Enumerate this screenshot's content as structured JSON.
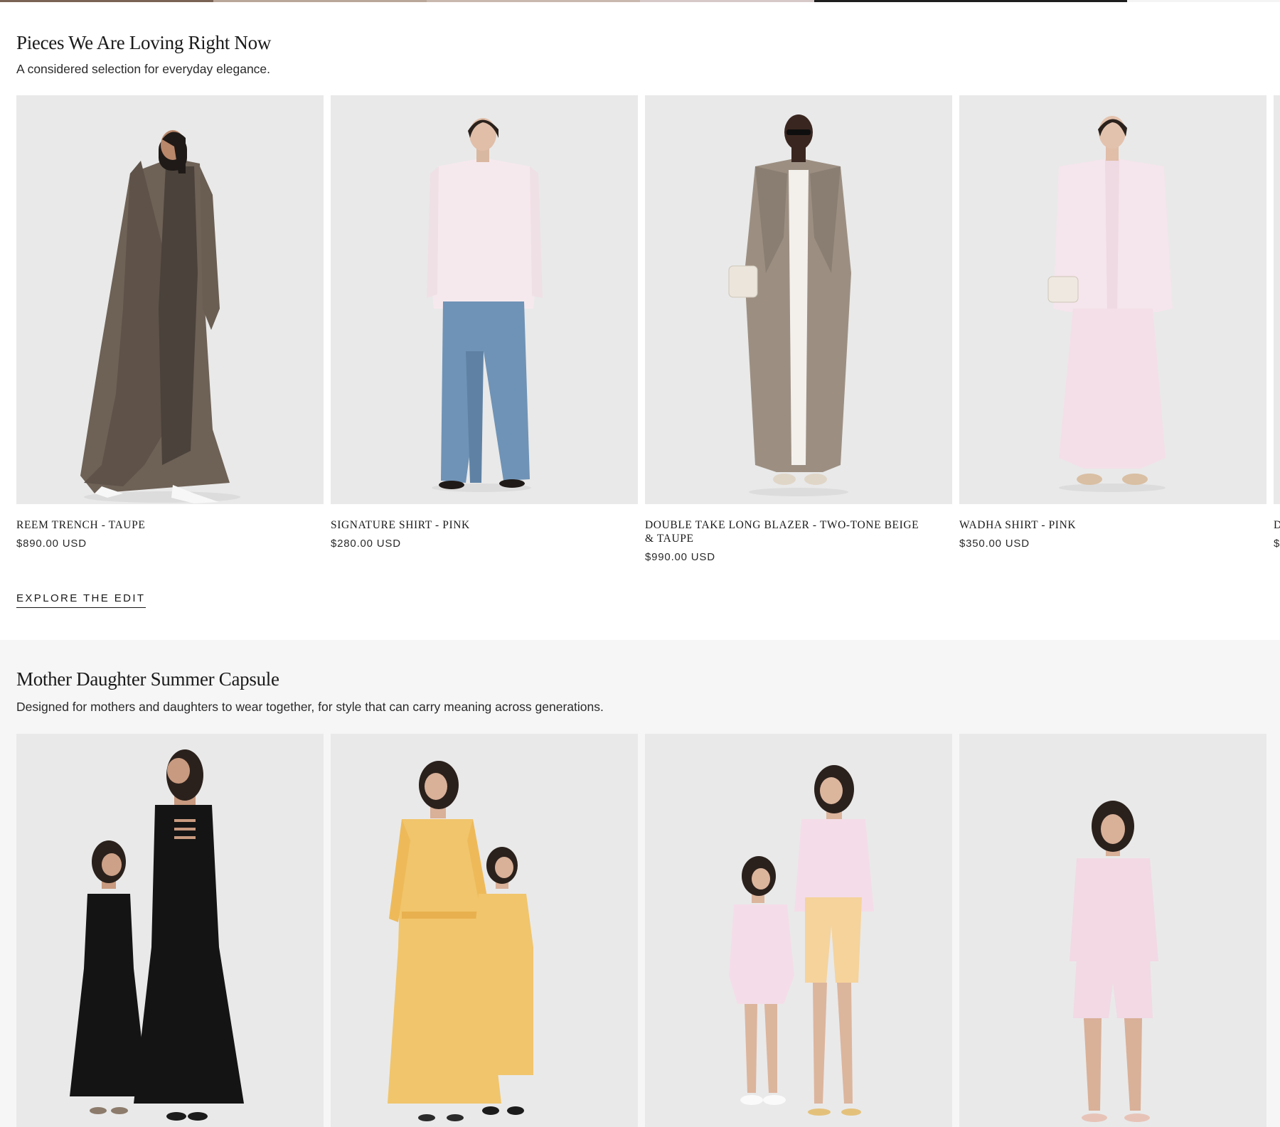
{
  "top_strip": {
    "colors": [
      "#7a6354",
      "#b9a79a",
      "#c9b8ae",
      "#d8c9c9",
      "#1e1e1e",
      "#f4f4f4"
    ]
  },
  "featured": {
    "title": "Pieces We Are Loving Right Now",
    "subtitle": "A considered selection for everyday elegance.",
    "products": [
      {
        "name": "REEM TRENCH - TAUPE",
        "price": "$890.00 USD",
        "image_icon": "model-in-taupe-trench-image"
      },
      {
        "name": "SIGNATURE SHIRT - PINK",
        "price": "$280.00 USD",
        "image_icon": "model-in-pink-shirt-and-jeans-image"
      },
      {
        "name": "DOUBLE TAKE LONG BLAZER - TWO-TONE BEIGE & TAUPE",
        "price": "$990.00 USD",
        "image_icon": "model-in-long-beige-blazer-image"
      },
      {
        "name": "WADHA SHIRT - PINK",
        "price": "$350.00 USD",
        "image_icon": "model-in-pink-shirt-and-skirt-image"
      },
      {
        "name": "D",
        "price": "$",
        "image_icon": "partially-visible-product-image"
      }
    ],
    "cta_label": "EXPLORE THE EDIT"
  },
  "capsule": {
    "title": "Mother Daughter Summer Capsule",
    "subtitle": "Designed for mothers and daughters to wear together, for style that can carry meaning across generations.",
    "products": [
      {
        "image_icon": "mother-daughter-black-dresses-image"
      },
      {
        "image_icon": "mother-daughter-yellow-stripe-dresses-image"
      },
      {
        "image_icon": "mother-daughter-pink-shirts-image"
      },
      {
        "image_icon": "girl-in-pink-shirt-and-shorts-image"
      }
    ]
  },
  "colors": {
    "text": "#1a1a1a",
    "image_backdrop": "#e9e9e9",
    "capsule_background": "#f6f6f6"
  }
}
